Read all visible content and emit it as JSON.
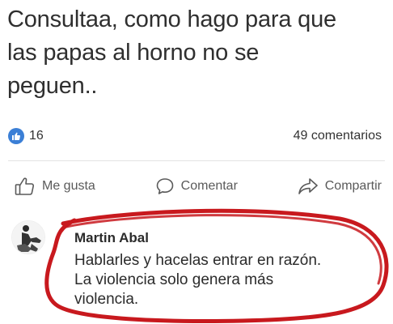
{
  "post": {
    "text_lines": [
      "Consultaa, como hago para que",
      "las papas al horno no se",
      "peguen.."
    ]
  },
  "stats": {
    "likes_count": "16",
    "comments_count": "49 comentarios"
  },
  "actions": {
    "like_label": "Me gusta",
    "comment_label": "Comentar",
    "share_label": "Compartir"
  },
  "comment": {
    "author": "Martin Abal",
    "body_lines": [
      "Hablarles y hacelas entrar en razón.",
      "La violencia solo genera más",
      "violencia."
    ]
  },
  "colors": {
    "like_badge": "#3b7fd6",
    "highlight_circle": "#c8191e"
  },
  "icons": {
    "like_badge": "thumbs-up-icon",
    "like_action": "thumbs-up-outline-icon",
    "comment_action": "speech-bubble-icon",
    "share_action": "share-arrow-icon"
  }
}
